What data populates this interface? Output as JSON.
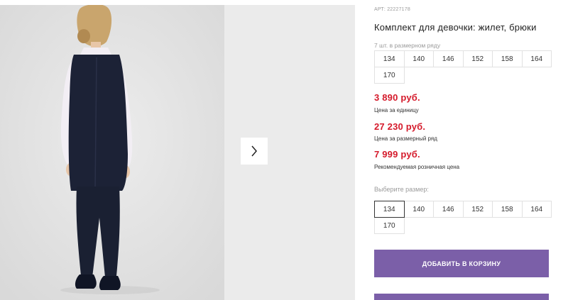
{
  "gallery": {
    "next_icon": "chevron-right-icon"
  },
  "product": {
    "art_label": "АРТ:",
    "art_number": "22227178",
    "title": "Комплект для девочки: жилет, брюки",
    "series_label": "7 шт. в размерном ряду",
    "series_sizes": [
      "134",
      "140",
      "146",
      "152",
      "158",
      "164",
      "170"
    ],
    "prices": [
      {
        "value": "3 890 руб.",
        "note": "Цена за единицу"
      },
      {
        "value": "27 230 руб.",
        "note": "Цена за размерный ряд"
      },
      {
        "value": "7 999 руб.",
        "note": "Рекомендуемая розничная цена"
      }
    ],
    "choose_size_label": "Выберите размер:",
    "select_sizes": [
      "134",
      "140",
      "146",
      "152",
      "158",
      "164",
      "170"
    ],
    "selected_size": "134",
    "add_to_cart_label": "ДОБАВИТЬ В КОРЗИНУ",
    "colors": {
      "price": "#d51a2b",
      "button": "#7b5fa8"
    }
  }
}
